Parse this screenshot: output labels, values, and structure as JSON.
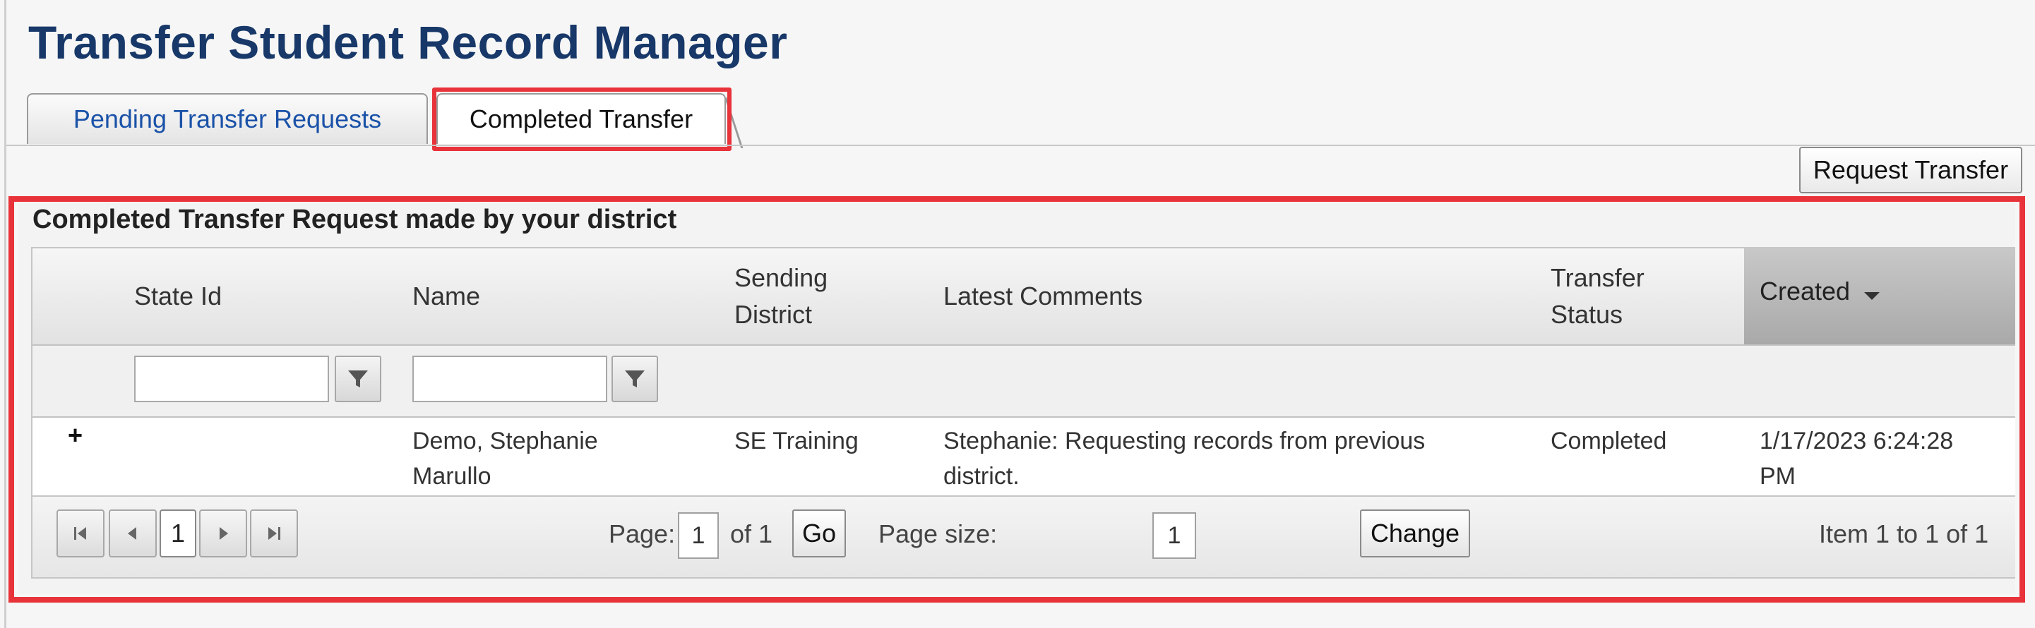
{
  "page": {
    "title": "Transfer Student Record Manager"
  },
  "tabs": [
    {
      "label": "Pending Transfer Requests",
      "active": false
    },
    {
      "label": "Completed Transfer",
      "active": true
    }
  ],
  "toolbar": {
    "request_transfer_label": "Request Transfer"
  },
  "panel": {
    "caption": "Completed Transfer Request made by your district"
  },
  "grid": {
    "columns": {
      "state_id": "State Id",
      "name": "Name",
      "sending_district_1": "Sending",
      "sending_district_2": "District",
      "latest_comments": "Latest Comments",
      "transfer_status_1": "Transfer",
      "transfer_status_2": "Status",
      "created": "Created"
    },
    "sort": {
      "column": "Created",
      "direction": "descending"
    },
    "filters": {
      "state_id": "",
      "name": ""
    },
    "rows": [
      {
        "expand": "+",
        "state_id": "",
        "name_line1": "Demo, Stephanie",
        "name_line2": "Marullo",
        "sending_district": "SE Training",
        "comments_line1": "Stephanie: Requesting records from previous",
        "comments_line2": "district.",
        "status": "Completed",
        "created_line1": "1/17/2023 6:24:28",
        "created_line2": "PM"
      }
    ]
  },
  "pager": {
    "current_page_button": "1",
    "page_label": "Page:",
    "page_value": "1",
    "of_label": "of 1",
    "go_label": "Go",
    "page_size_label": "Page size:",
    "page_size_value": "1",
    "change_label": "Change",
    "summary": "Item 1 to 1 of 1"
  },
  "colors": {
    "title": "#173868",
    "link": "#1a52a8",
    "highlight": "#e8333a"
  }
}
